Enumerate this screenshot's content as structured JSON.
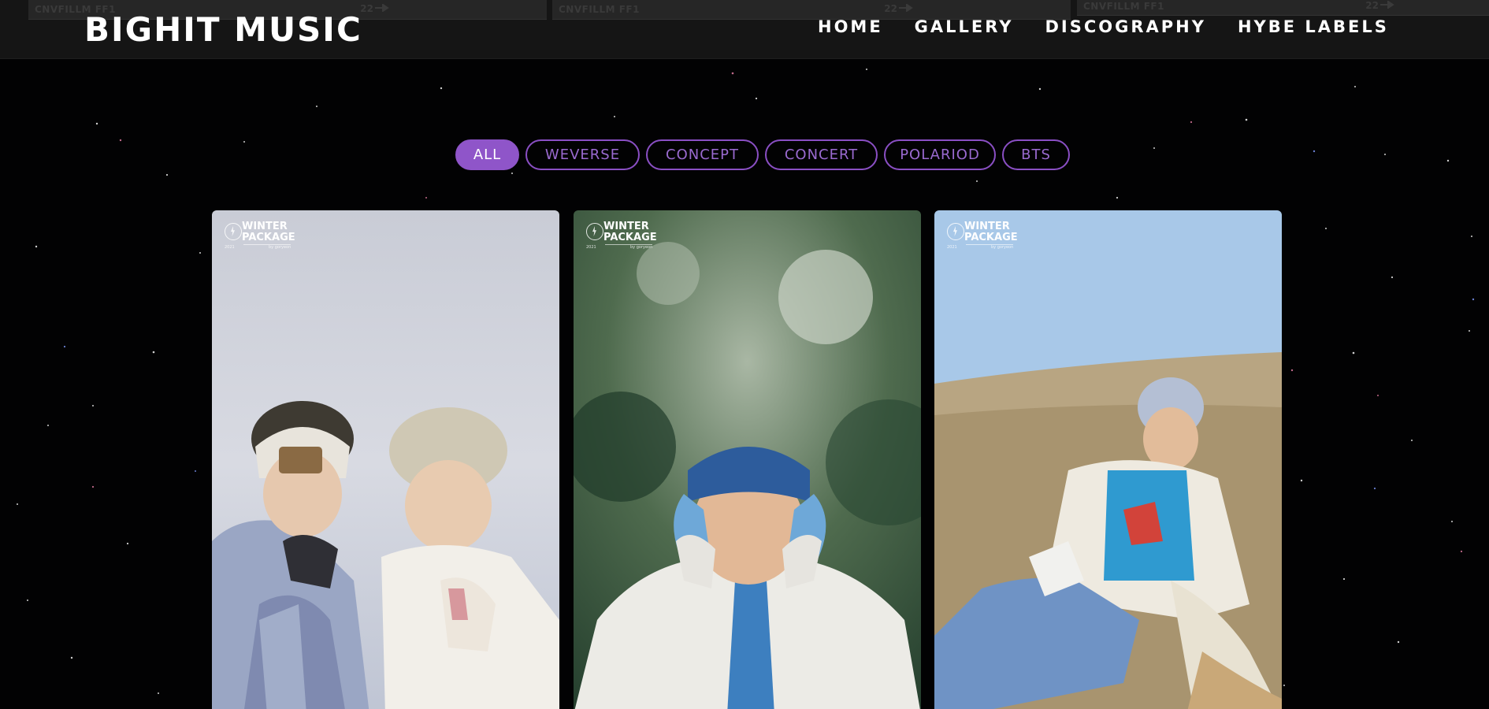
{
  "header": {
    "logo": "BIGHIT MUSIC",
    "nav": [
      {
        "label": "HOME"
      },
      {
        "label": "GALLERY"
      },
      {
        "label": "DISCOGRAPHY"
      },
      {
        "label": "HYBE LABELS"
      }
    ],
    "film_strips": [
      {
        "code": "CNVFILLM FF1",
        "num": "22"
      },
      {
        "code": "CNVFILLM FF1",
        "num": "22"
      },
      {
        "code": "CNVFILLM FF1",
        "num": "22"
      }
    ]
  },
  "filters": {
    "active": "ALL",
    "items": [
      {
        "label": "ALL"
      },
      {
        "label": "WEVERSE"
      },
      {
        "label": "CONCEPT"
      },
      {
        "label": "CONCERT"
      },
      {
        "label": "POLARIOD"
      },
      {
        "label": "BTS"
      }
    ]
  },
  "gallery": {
    "cards": [
      {
        "badge_title": "WINTER\nPACKAGE",
        "badge_year": "2021",
        "badge_by": "by goryeon",
        "scene": "two members in snow wearing winter hats and padded jackets"
      },
      {
        "badge_title": "WINTER\nPACKAGE",
        "badge_year": "2021",
        "badge_by": "by goryeon",
        "scene": "member in blue knit headband and fleece jacket in a pine forest"
      },
      {
        "badge_title": "WINTER\nPACKAGE",
        "badge_year": "2021",
        "badge_by": "by goryeon",
        "scene": "member in blue sweater and white coat sitting on a grassy hill"
      }
    ]
  },
  "colors": {
    "background": "#020203",
    "header": "#151515",
    "accent": "#8f55c9",
    "pill_text": "#9a6ad0",
    "text": "#ffffff"
  }
}
